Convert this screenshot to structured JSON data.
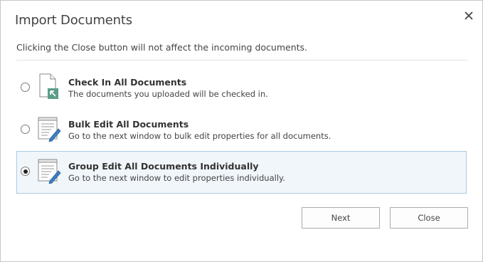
{
  "dialog": {
    "title": "Import Documents",
    "close_icon": "close-icon",
    "subtitle": "Clicking the Close button will not affect the incoming documents."
  },
  "options": [
    {
      "title": "Check In All Documents",
      "description": "The documents you uploaded will be checked in.",
      "icon": "check-in-document-icon",
      "selected": false
    },
    {
      "title": "Bulk Edit All Documents",
      "description": "Go to the next window to bulk edit properties for all documents.",
      "icon": "edit-document-icon",
      "selected": false
    },
    {
      "title": "Group Edit All Documents Individually",
      "description": "Go to the next window to edit properties individually.",
      "icon": "edit-document-icon",
      "selected": true
    }
  ],
  "buttons": {
    "next": "Next",
    "close": "Close"
  },
  "colors": {
    "selected_background": "#f1f6fb",
    "selected_border": "#a9cbe3",
    "check_in_arrow": "#5a9e8a",
    "pencil": "#3d7fc1"
  }
}
